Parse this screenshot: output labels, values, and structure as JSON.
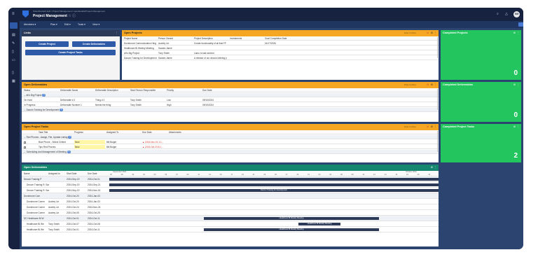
{
  "app": {
    "breadcrumb": "ShareDecide3.Hub / Project Management / open/details/Project-Management",
    "title": "Project Management",
    "title_suffix": "☆ ⓘ",
    "avatar": "SM"
  },
  "menus": [
    {
      "label": "Members ▾"
    },
    {
      "label": "Plan ▾"
    },
    {
      "label": "Edit ▾"
    },
    {
      "label": "Tools ▾"
    },
    {
      "label": "View ▾"
    }
  ],
  "links": {
    "title": "Links",
    "buttons": [
      "Create Project",
      "Create Deliverables",
      "Create Project Tasks"
    ]
  },
  "open_projects": {
    "title": "Open Projects",
    "filter": "Filter Further",
    "columns": [
      "Project Name",
      "Person Owned",
      "Project Description",
      "Investments",
      "Goal Completion Date"
    ],
    "rows": [
      [
        "Dunshrone Communication Hing",
        "Audrey Lin",
        "Create functionality of all that FF",
        "",
        "04/17/2026"
      ],
      [
        "Healthcare Bi Weekly Meeting",
        "Sandra Jamie",
        "",
        "",
        ""
      ],
      [
        "Ali's Big Project",
        "Tony Smith",
        "Lamu to last worked",
        "",
        ""
      ],
      [
        "Dacom Training for Development",
        "Sandra Jamie",
        "A release of our decom training p",
        "",
        ""
      ]
    ]
  },
  "completed_projects": {
    "title": "Completed Projects",
    "count": "0"
  },
  "open_deliverables": {
    "title": "Open Deliverables",
    "filter": "Filter Further",
    "columns": [
      "Status",
      "Deliverable Name",
      "Deliverable Description",
      "Start Person Responsible",
      "Priority",
      "Due Date"
    ],
    "groups": [
      {
        "label": "Ali's Big Project",
        "count": "2"
      },
      {
        "label": "Dacom Training for Development",
        "count": "3"
      }
    ],
    "rows": [
      [
        "On Hold",
        "Deliverable # 2",
        "Thing # 2",
        "Tony Smith",
        "Low",
        "09/15/2024"
      ],
      [
        "In Progress",
        "Deliverable Number 1",
        "Needs the thing",
        "Tony Smith",
        "High",
        "09/15/2024"
      ]
    ]
  },
  "completed_deliverables": {
    "title": "Completed Deliverables",
    "count": "0"
  },
  "open_tasks": {
    "title": "Open Project Tasks",
    "filter": "Filter Further",
    "columns": [
      "Task Title",
      "Progress",
      "Assigned To",
      "Due Date",
      "Attachments"
    ],
    "groups": [
      {
        "label": "Red Phones - Assign, File, Update Listing",
        "count": "2"
      },
      {
        "label": "Scheduling and Management of Meeting",
        "count": "3"
      }
    ],
    "rows": [
      [
        "Blue Phone - Select Chlient",
        "New",
        "Bill Bulger",
        "▲ 2024-Nov-01 1:1...",
        ""
      ],
      [
        "Tips Red Phones",
        "New",
        "Bill Bulger",
        "▲ 2024-Oct-23 8:1...",
        ""
      ]
    ]
  },
  "completed_tasks": {
    "title": "Completed Project Tasks",
    "count": "2"
  },
  "gantt": {
    "title": "Open Deliverables",
    "columns": [
      "Name",
      "Assigned to",
      "Start Date",
      "Due Date"
    ],
    "month_left": "September 2024",
    "month_right": "October 2024",
    "days": [
      "26",
      "28",
      "30",
      "01",
      "03",
      "05",
      "07",
      "09",
      "11",
      "13",
      "15",
      "17",
      "19",
      "21",
      "23",
      "25",
      "27",
      "29",
      "31",
      "02",
      "04",
      "06",
      "08",
      "10",
      "12",
      "14",
      "16",
      "18",
      "20",
      "22"
    ],
    "rows": [
      {
        "group": true,
        "name": "Decom Training P",
        "assigned": "",
        "start": "2024-Sep-19",
        "due": "2024-Oct-01"
      },
      {
        "group": false,
        "name": "Decom Training R. Sandra Jamie",
        "assigned": "",
        "start": "2024-Sep-19",
        "due": "2024-Sep-21"
      },
      {
        "group": false,
        "name": "Decom Training R. Sandra Jamie",
        "assigned": "",
        "start": "2024-Sep-19",
        "due": "2024-Nov-01"
      },
      {
        "group": true,
        "name": "Dunshrone Com",
        "assigned": "",
        "start": "2024-Oct-20",
        "due": "2024-Jan-03"
      },
      {
        "group": false,
        "name": "Dunshrone Comm",
        "assigned": "Audrey Lin",
        "start": "2024-Oct-20",
        "due": "2024-Jan-03"
      },
      {
        "group": false,
        "name": "Dunshrone Comm",
        "assigned": "Audrey Lin",
        "start": "2024-Oct-24",
        "due": "2024-Nov-24"
      },
      {
        "group": false,
        "name": "Dunshrone Comm",
        "assigned": "Audrey Lin",
        "start": "2024-Oct-05",
        "due": "2024-Oct-25"
      },
      {
        "group": true,
        "name": "DC Healthcare Bi W",
        "assigned": "",
        "start": "2024-Oct-01",
        "due": "2024-Oct-11"
      },
      {
        "group": false,
        "name": "Healthcare Bi We",
        "assigned": "Tony Smith",
        "start": "2024-Oct-07",
        "due": "2024-Oct-08"
      },
      {
        "group": false,
        "name": "Healthcare Bi We",
        "assigned": "Tony Smith",
        "start": "2024-Oct-01",
        "due": "2024-Oct-11"
      }
    ],
    "bars": [
      {
        "label": ""
      },
      {
        "label": ""
      },
      {
        "label": "Decom Training for Development"
      },
      {
        "label": ""
      },
      {
        "label": ""
      },
      {
        "label": ""
      },
      {
        "label": ""
      },
      {
        "label": "Healthcare Bi Weekly Meeting"
      },
      {
        "label": "Healthcare Bi Weekly Meeting"
      },
      {
        "label": "Healthcare Bi Weekly Meeting"
      }
    ]
  }
}
